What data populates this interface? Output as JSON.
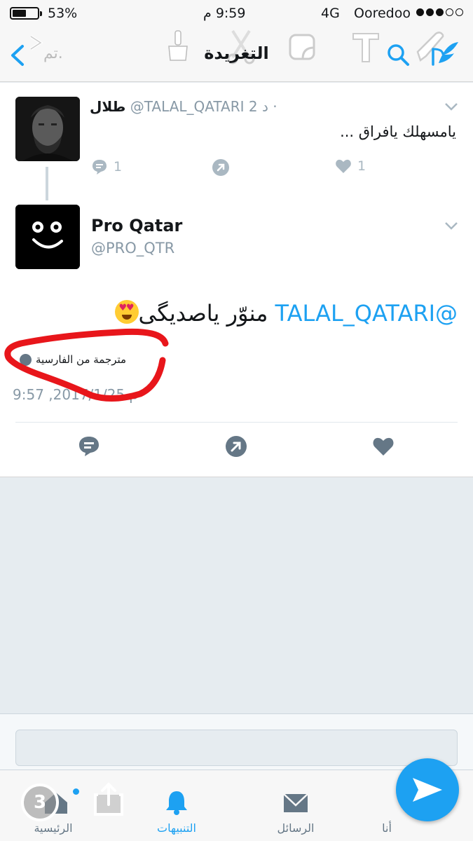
{
  "status_bar": {
    "battery_percent": "53%",
    "battery_level": 0.53,
    "time": "9:59 م",
    "network": "4G",
    "carrier": "Ooredoo",
    "signal_bars": 3
  },
  "nav": {
    "title": "التغريدة",
    "back_label": "تم."
  },
  "tweet1": {
    "name": "طلال",
    "handle": "@TALAL_QATARI",
    "time": "2 د ·",
    "text": "يامسهلك يافراق ...",
    "reply_count": "1",
    "like_count": "1"
  },
  "tweet2": {
    "name": "Pro Qatar",
    "handle": "@PRO_QTR",
    "mention": "@TALAL_QATARI",
    "text": "منوّر ياصديگی",
    "translated_label": "مترجمة من الفارسية",
    "timestamp": "9:57 ,2017/1/25 م"
  },
  "reply_bar": {
    "placeholder": ""
  },
  "tabs": [
    {
      "label": "الرئيسية",
      "icon": "home-icon"
    },
    {
      "label": "",
      "icon": "share-icon"
    },
    {
      "label": "التنبيهات",
      "icon": "bell-icon"
    },
    {
      "label": "الرسائل",
      "icon": "envelope-icon"
    },
    {
      "label": "أنا",
      "icon": "person-icon"
    }
  ],
  "overlay": {
    "timer": "3"
  },
  "colors": {
    "accent": "#1da1f2",
    "annotation": "#e8161b"
  }
}
